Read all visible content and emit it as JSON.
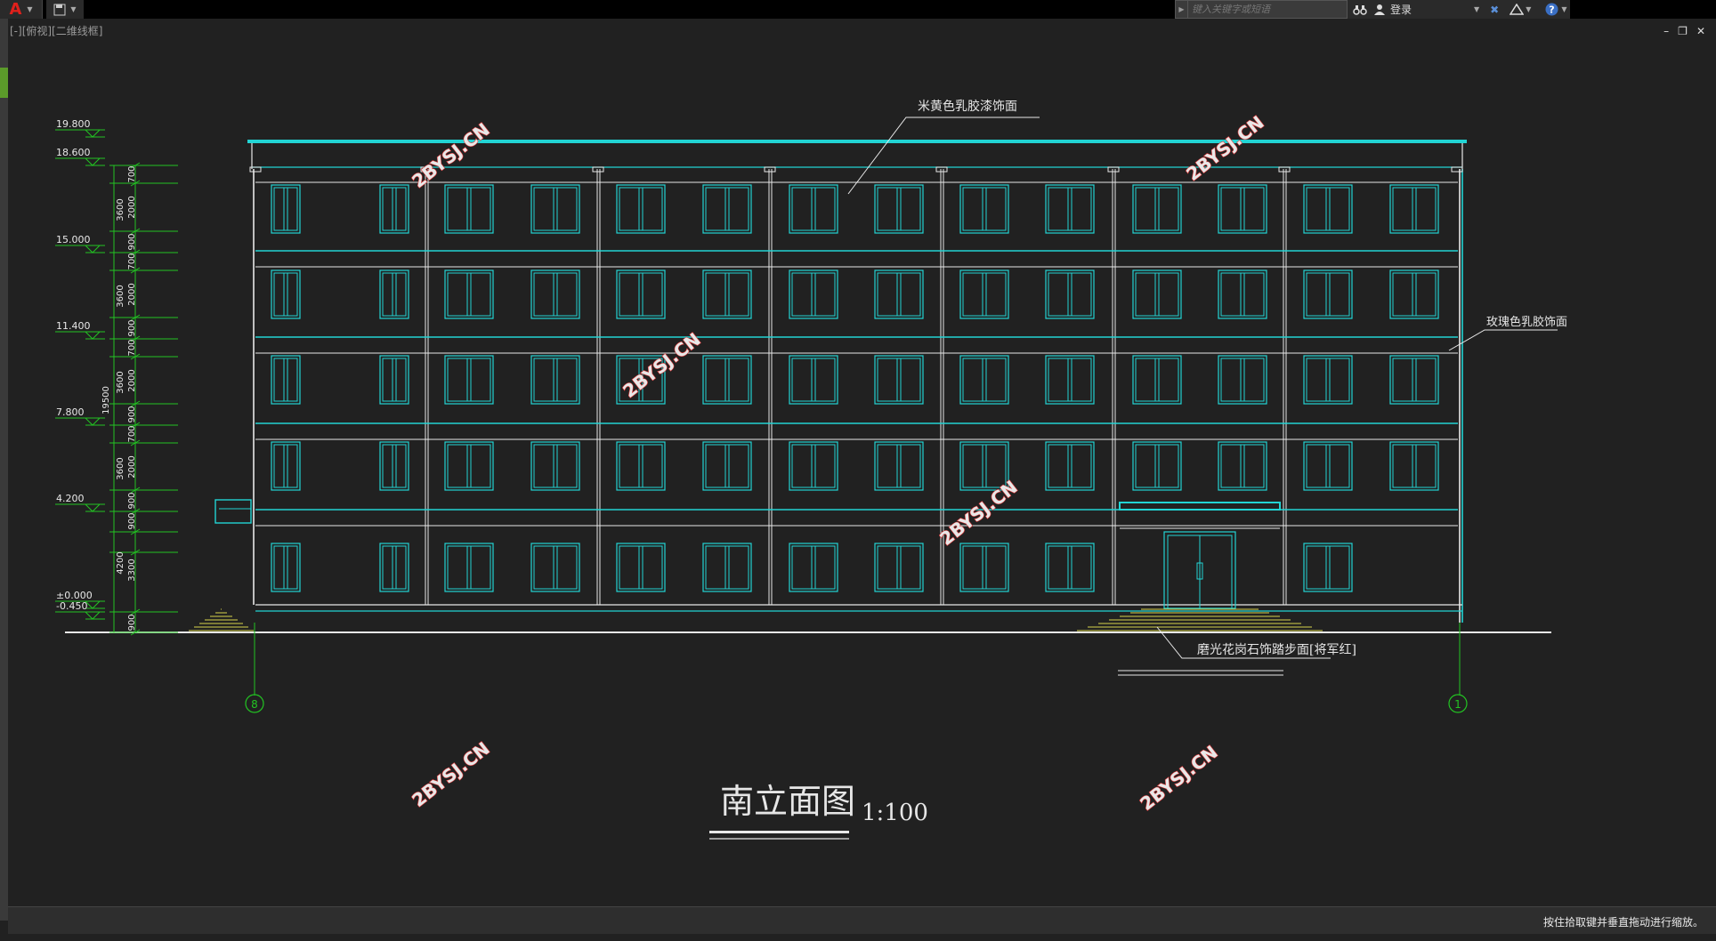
{
  "titlebar": {
    "app_logo": "A",
    "search_placeholder": "键入关键字或短语",
    "login_label": "登录",
    "icons": [
      "autocad-logo-icon",
      "save-icon",
      "binoculars-icon",
      "user-icon",
      "exchange-icon",
      "a360-icon",
      "help-icon"
    ]
  },
  "viewport": {
    "label": "[-][俯视][二维线框]"
  },
  "window_controls": {
    "minimize": "–",
    "restore": "❐",
    "close": "✕"
  },
  "drawing": {
    "title": "南立面图",
    "scale": "1:100",
    "note_top": "米黄色乳胶漆饰面",
    "note_right": "玫瑰色乳胶饰面",
    "note_bottom": "磨光花岗石饰踏步面[将军红]",
    "axis_left": "8",
    "axis_right": "1",
    "elevations": [
      "19.800",
      "18.600",
      "15.000",
      "11.400",
      "7.800",
      "4.200",
      "±0.000",
      "-0.450"
    ],
    "dims_inner": [
      "700",
      "2000",
      "900",
      "700",
      "2000",
      "900",
      "700",
      "2000",
      "900",
      "700",
      "2000",
      "900",
      "900",
      "3300",
      "900"
    ],
    "dims_outer": [
      "3600",
      "3600",
      "3600",
      "3600",
      "4200"
    ],
    "dim_total": "19500",
    "watermark": "2BYSJ.CN",
    "colors": {
      "cyan": "#22d4d4",
      "white": "#e8e8e8",
      "green": "#22c422",
      "yellow": "#d6d24a",
      "background": "#212121"
    }
  },
  "status": {
    "command_message": "按住拾取键并垂直拖动进行缩放。"
  }
}
